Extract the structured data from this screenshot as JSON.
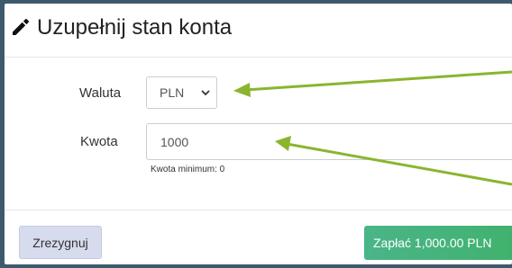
{
  "modal": {
    "title": "Uzupełnij stan konta",
    "title_icon": "pencil-icon"
  },
  "form": {
    "currency_label": "Waluta",
    "currency_value": "PLN",
    "amount_label": "Kwota",
    "amount_value": "1000",
    "amount_hint": "Kwota minimum: 0"
  },
  "footer": {
    "cancel_label": "Zrezygnuj",
    "pay_label": "Zapłać 1,000.00 PLN"
  },
  "colors": {
    "annotation_arrow": "#8ab52e",
    "pay_button": "#3fb168",
    "cancel_button": "#d7dbee",
    "backdrop": "#3d5a6c"
  }
}
